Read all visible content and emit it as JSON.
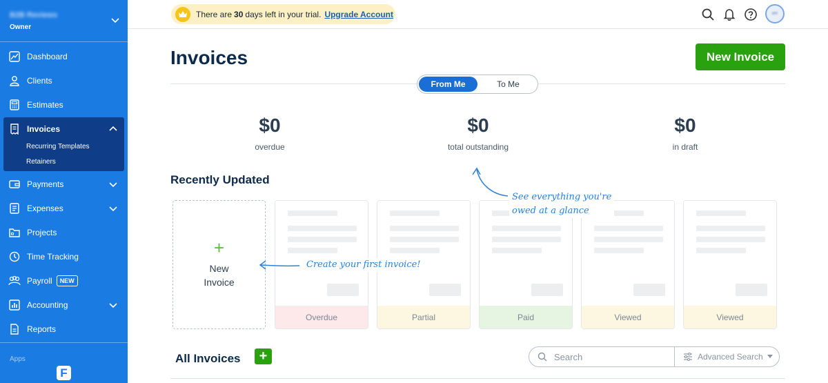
{
  "sidebar": {
    "business_name": "B2B Reviews",
    "role": "Owner",
    "nav": {
      "dashboard": "Dashboard",
      "clients": "Clients",
      "estimates": "Estimates",
      "invoices": "Invoices",
      "recurring_templates": "Recurring Templates",
      "retainers": "Retainers",
      "payments": "Payments",
      "expenses": "Expenses",
      "projects": "Projects",
      "time_tracking": "Time Tracking",
      "payroll": "Payroll",
      "payroll_badge": "NEW",
      "accounting": "Accounting",
      "reports": "Reports"
    },
    "apps_label": "Apps",
    "logo_letter": "F"
  },
  "topbar": {
    "trial_prefix": "There are",
    "trial_days": "30",
    "trial_suffix": "days left in your trial.",
    "upgrade_link": "Upgrade Account",
    "avatar_initials": "BR"
  },
  "main": {
    "title": "Invoices",
    "new_invoice_button": "New Invoice",
    "toggle": {
      "from_me": "From Me",
      "to_me": "To Me"
    },
    "stats": [
      {
        "amount": "$0",
        "label": "overdue"
      },
      {
        "amount": "$0",
        "label": "total outstanding"
      },
      {
        "amount": "$0",
        "label": "in draft"
      }
    ],
    "recently_updated_title": "Recently Updated",
    "new_card": {
      "plus": "+",
      "line1": "New",
      "line2": "Invoice"
    },
    "status_cards": [
      {
        "status": "Overdue",
        "color": "#fde8ea"
      },
      {
        "status": "Partial",
        "color": "#fdf7e1"
      },
      {
        "status": "Paid",
        "color": "#e6f4e2"
      },
      {
        "status": "Viewed",
        "color": "#fdf7e1"
      },
      {
        "status": "Viewed",
        "color": "#fdf7e1"
      }
    ],
    "annotations": {
      "glance_line1": "See everything you're",
      "glance_line2": "owed at a glance",
      "first_invoice": "Create your first invoice!"
    },
    "all_invoices_title": "All Invoices",
    "add_symbol": "+",
    "search": {
      "placeholder": "Search",
      "advanced": "Advanced Search"
    }
  },
  "colors": {
    "sidebar": "#1a7be3",
    "sidebar_active": "#0f3d88",
    "primary_green": "#2aa10f",
    "toggle_active": "#1a6fd6",
    "annotation_blue": "#2b80d6",
    "trial_banner": "#fdf0c4"
  }
}
